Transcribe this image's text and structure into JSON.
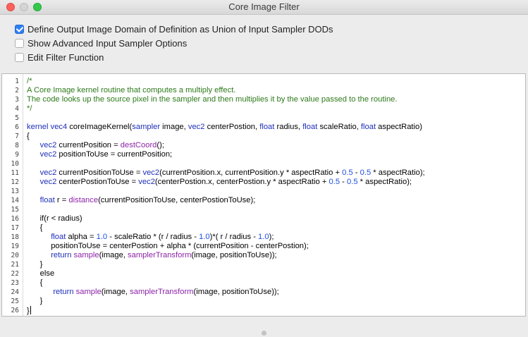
{
  "window": {
    "title": "Core Image Filter"
  },
  "options": [
    {
      "label": "Define Output Image Domain of Definition as Union of Input Sampler DODs",
      "checked": true
    },
    {
      "label": "Show Advanced Input Sampler Options",
      "checked": false
    },
    {
      "label": "Edit Filter Function",
      "checked": false
    }
  ],
  "editor": {
    "line_numbers": [
      "1",
      "2",
      "3",
      "4",
      "5",
      "6",
      "7",
      "8",
      "9",
      "10",
      "11",
      "12",
      "13",
      "14",
      "15",
      "16",
      "17",
      "18",
      "19",
      "20",
      "21",
      "22",
      "23",
      "24",
      "25",
      "26"
    ],
    "lines": [
      [
        [
          "/*",
          "cmt"
        ]
      ],
      [
        [
          "A Core Image kernel routine that computes a multiply effect.",
          "cmt"
        ]
      ],
      [
        [
          "The code looks up the source pixel in the sampler and then multiplies it by the value passed to the routine.",
          "cmt"
        ]
      ],
      [
        [
          "*/",
          "cmt"
        ]
      ],
      [],
      [
        [
          "kernel",
          "kw"
        ],
        [
          " "
        ],
        [
          "vec4",
          "kw"
        ],
        [
          " coreImageKernel("
        ],
        [
          "sampler",
          "kw"
        ],
        [
          " image, "
        ],
        [
          "vec2",
          "kw"
        ],
        [
          " centerPostion, "
        ],
        [
          "float",
          "kw"
        ],
        [
          " radius, "
        ],
        [
          "float",
          "kw"
        ],
        [
          " scaleRatio, "
        ],
        [
          "float",
          "kw"
        ],
        [
          " aspectRatio)"
        ]
      ],
      [
        [
          "{"
        ]
      ],
      [
        [
          "      "
        ],
        [
          "vec2",
          "kw"
        ],
        [
          " currentPosition = "
        ],
        [
          "destCoord",
          "fn"
        ],
        [
          "();"
        ]
      ],
      [
        [
          "      "
        ],
        [
          "vec2",
          "kw"
        ],
        [
          " positionToUse = currentPosition;"
        ]
      ],
      [],
      [
        [
          "      "
        ],
        [
          "vec2",
          "kw"
        ],
        [
          " currentPositionToUse = "
        ],
        [
          "vec2",
          "kw"
        ],
        [
          "(currentPosition.x, currentPosition.y * aspectRatio + "
        ],
        [
          "0.5",
          "num"
        ],
        [
          " - "
        ],
        [
          "0.5",
          "num"
        ],
        [
          " * aspectRatio);"
        ]
      ],
      [
        [
          "      "
        ],
        [
          "vec2",
          "kw"
        ],
        [
          " centerPostionToUse = "
        ],
        [
          "vec2",
          "kw"
        ],
        [
          "(centerPostion.x, centerPostion.y * aspectRatio + "
        ],
        [
          "0.5",
          "num"
        ],
        [
          " - "
        ],
        [
          "0.5",
          "num"
        ],
        [
          " * aspectRatio);"
        ]
      ],
      [],
      [
        [
          "      "
        ],
        [
          "float",
          "kw"
        ],
        [
          " r = "
        ],
        [
          "distance",
          "fn"
        ],
        [
          "(currentPositionToUse, centerPostionToUse);"
        ]
      ],
      [],
      [
        [
          "      if(r < radius)"
        ]
      ],
      [
        [
          "      {"
        ]
      ],
      [
        [
          "           "
        ],
        [
          "float",
          "kw"
        ],
        [
          " alpha = "
        ],
        [
          "1.0",
          "num"
        ],
        [
          " - scaleRatio * (r / radius - "
        ],
        [
          "1.0",
          "num"
        ],
        [
          ")*( r / radius - "
        ],
        [
          "1.0",
          "num"
        ],
        [
          ");"
        ]
      ],
      [
        [
          "           positionToUse = centerPostion + alpha * (currentPosition - centerPostion);"
        ]
      ],
      [
        [
          "           "
        ],
        [
          "return",
          "kw"
        ],
        [
          " "
        ],
        [
          "sample",
          "fn"
        ],
        [
          "(image, "
        ],
        [
          "samplerTransform",
          "fn"
        ],
        [
          "(image, positionToUse));"
        ]
      ],
      [
        [
          "      }"
        ]
      ],
      [
        [
          "      else"
        ]
      ],
      [
        [
          "      {"
        ]
      ],
      [
        [
          "            "
        ],
        [
          "return",
          "kw"
        ],
        [
          " "
        ],
        [
          "sample",
          "fn"
        ],
        [
          "(image, "
        ],
        [
          "samplerTransform",
          "fn"
        ],
        [
          "(image, positionToUse));"
        ]
      ],
      [
        [
          "      }"
        ]
      ],
      [
        [
          "}"
        ]
      ]
    ]
  },
  "colors": {
    "comment": "#2d7a1a",
    "keyword": "#1d2fb8",
    "function": "#8d23a8",
    "number": "#1c4fe0",
    "checkbox_accent": "#2f7ff4"
  },
  "icons": {
    "close": "close-icon",
    "minimize": "minimize-icon",
    "zoom": "zoom-icon",
    "resize": "resize-handle-icon"
  }
}
